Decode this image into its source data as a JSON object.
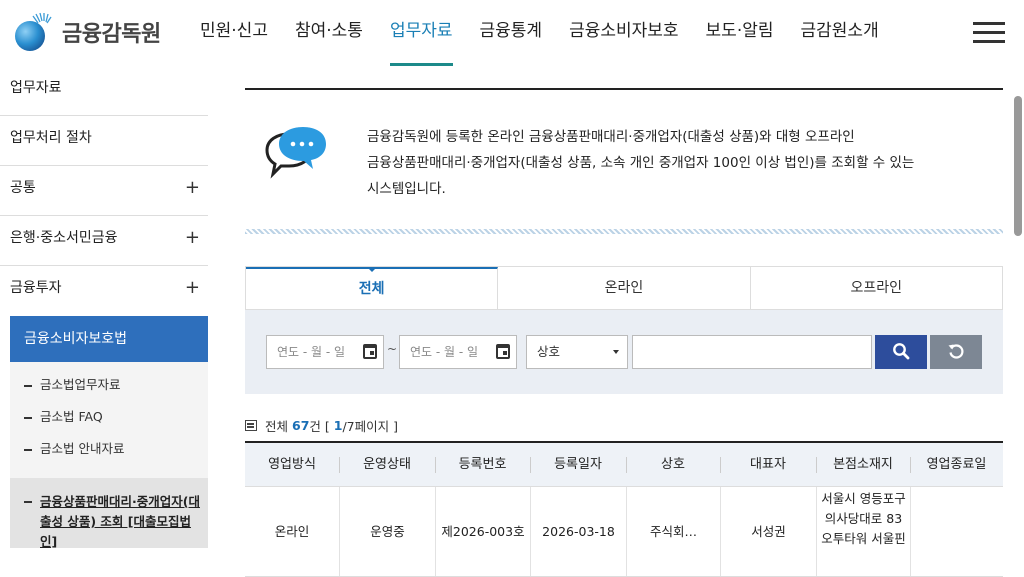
{
  "logo": {
    "text": "금융감독원"
  },
  "gnb": {
    "items": [
      {
        "label": "민원·신고"
      },
      {
        "label": "참여·소통"
      },
      {
        "label": "업무자료",
        "active": true
      },
      {
        "label": "금융통계"
      },
      {
        "label": "금융소비자보호"
      },
      {
        "label": "보도·알림"
      },
      {
        "label": "금감원소개"
      }
    ]
  },
  "sidebar": {
    "items": [
      {
        "label": "업무자료"
      },
      {
        "label": "업무처리 절차"
      },
      {
        "label": "공통",
        "expand": "+"
      },
      {
        "label": "은행·중소서민금융",
        "expand": "+"
      },
      {
        "label": "금융투자",
        "expand": "+"
      }
    ],
    "active": "금융소비자보호법",
    "sub": [
      "금소법업무자료",
      "금소법 FAQ",
      "금소법 안내자료"
    ],
    "sub2": "금융상품판매대리·중개업자(대출성 상품) 조회 [대출모집법인]"
  },
  "intro": {
    "line1": "금융감독원에 등록한 온라인 금융상품판매대리·중개업자(대출성 상품)와 대형 오프라인",
    "line2": "금융상품판매대리·중개업자(대출성 상품, 소속 개인 중개업자 100인 이상 법인)를 조회할 수 있는",
    "line3": "시스템입니다."
  },
  "tabs": [
    {
      "label": "전체",
      "active": true
    },
    {
      "label": "온라인"
    },
    {
      "label": "오프라인"
    }
  ],
  "search": {
    "date_from": "연도 - 월 - 일",
    "date_to": "연도 - 월 - 일",
    "tilde": "~",
    "select_value": "상호",
    "keyword_value": ""
  },
  "count": {
    "prefix": "전체",
    "total": "67",
    "suffix": "건 [",
    "page": "1",
    "pages": "/7페이지 ]"
  },
  "table": {
    "headers": [
      "영업방식",
      "운영상태",
      "등록번호",
      "등록일자",
      "상호",
      "대표자",
      "본점소재지",
      "영업종료일"
    ],
    "rows": [
      [
        "온라인",
        "운영중",
        "제2026-003호",
        "2026-03-18",
        "주식회…",
        "서성권",
        "서울시 영등포구 의사당대로 83 오투타워 서울핀",
        ""
      ]
    ]
  },
  "colors": {
    "accent": "#1a6fb5",
    "snb_active": "#2e6fbc",
    "search_btn": "#2d4d9c",
    "reset_btn": "#7d8794",
    "search_bg": "#eaeef4"
  }
}
